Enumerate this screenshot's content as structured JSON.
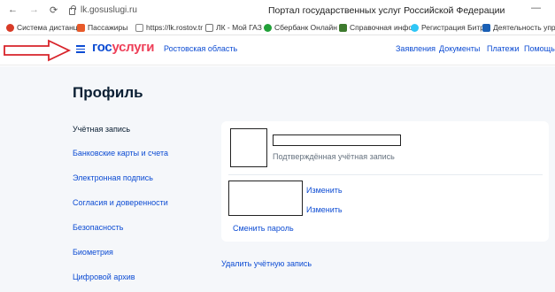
{
  "browser": {
    "back": "←",
    "forward": "→",
    "reload": "⟳",
    "url": "lk.gosuslugi.ru",
    "window_title": "Портал государственных услуг Российской Федерации",
    "minimize": "—"
  },
  "bookmarks": [
    {
      "label": "Система дистанц",
      "color": "#d83b27"
    },
    {
      "label": "Пассажиры",
      "color": "#e85a2a"
    },
    {
      "label": "https://lk.rostov.tr",
      "color": "#888888"
    },
    {
      "label": "ЛК - Мой ГАЗ",
      "color": "#777777"
    },
    {
      "label": "Сбербанк Онлайн",
      "color": "#21a038"
    },
    {
      "label": "Справочная инфо",
      "color": "#3d7a2e"
    },
    {
      "label": "Регистрация Битр",
      "color": "#2fc6f6"
    },
    {
      "label": "Деятельность упр",
      "color": "#1a5fb4"
    }
  ],
  "header": {
    "logo_part1": "гос",
    "logo_part2": "услуги",
    "region": "Ростовская область",
    "nav": [
      "Заявления",
      "Документы",
      "Платежи",
      "Помощь"
    ]
  },
  "page": {
    "title": "Профиль",
    "sidebar": [
      "Учётная запись",
      "Банковские карты и счета",
      "Электронная подпись",
      "Согласия и доверенности",
      "Безопасность",
      "Биометрия",
      "Цифровой архив"
    ],
    "account": {
      "status": "Подтверждённая учётная запись",
      "edit_label_1": "Изменить",
      "edit_label_2": "Изменить",
      "change_password": "Сменить пароль"
    },
    "delete_account": "Удалить учётную запись"
  }
}
